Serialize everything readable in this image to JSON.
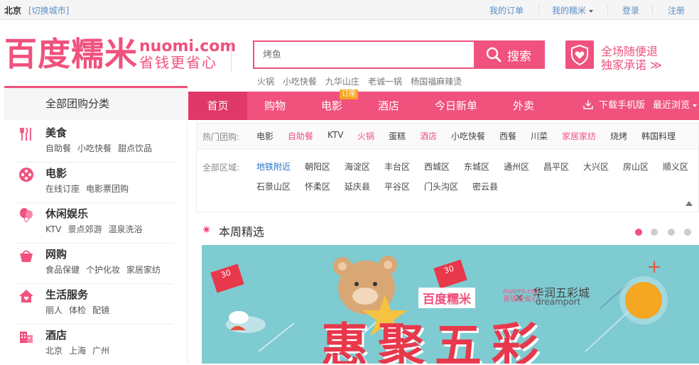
{
  "topbar": {
    "city": "北京",
    "switch_city": "[切换城市]",
    "my_orders": "我的订单",
    "my_nuomi": "我的糯米",
    "login": "登录",
    "register": "注册"
  },
  "logo": {
    "cn": "百度糯米",
    "en": "nuomi.com",
    "slogan": "省钱更省心"
  },
  "search": {
    "placeholder": "烤鱼",
    "button": "搜索",
    "hotwords": [
      "火锅",
      "小吃快餐",
      "九华山庄",
      "老诚一锅",
      "杨国福麻辣烫"
    ]
  },
  "promise": {
    "line1": "全场随便退",
    "line2": "独家承诺 ≫"
  },
  "nav": {
    "items": [
      "首页",
      "购物",
      "电影",
      "酒店",
      "今日新单",
      "外卖"
    ],
    "order_badge": "订座",
    "download": "下载手机版",
    "recent": "最近浏览"
  },
  "sidebar": {
    "title": "全部团购分类",
    "categories": [
      {
        "name": "美食",
        "subs": [
          "自助餐",
          "小吃快餐",
          "甜点饮品"
        ],
        "icon": "food-icon"
      },
      {
        "name": "电影",
        "subs": [
          "在线订座",
          "电影票团购"
        ],
        "icon": "film-reel-icon"
      },
      {
        "name": "休闲娱乐",
        "subs": [
          "KTV",
          "景点郊游",
          "温泉洗浴"
        ],
        "icon": "balloon-icon"
      },
      {
        "name": "网购",
        "subs": [
          "食品保健",
          "个护化妆",
          "家居家纺"
        ],
        "icon": "basket-icon"
      },
      {
        "name": "生活服务",
        "subs": [
          "丽人",
          "体检",
          "配镜"
        ],
        "icon": "house-icon"
      },
      {
        "name": "酒店",
        "subs": [
          "北京",
          "上海",
          "广州"
        ],
        "icon": "hotel-icon"
      }
    ]
  },
  "filter": {
    "hot_label": "热门团购:",
    "hot": [
      "电影",
      "自助餐",
      "KTV",
      "火锅",
      "蛋糕",
      "酒店",
      "小吃快餐",
      "西餐",
      "川菜",
      "家居家纺",
      "烧烤",
      "韩国料理"
    ],
    "area_label": "全部区域:",
    "areas": [
      "地铁附近",
      "朝阳区",
      "海淀区",
      "丰台区",
      "西城区",
      "东城区",
      "通州区",
      "昌平区",
      "大兴区",
      "房山区",
      "顺义区",
      "石景山区",
      "怀柔区",
      "延庆县",
      "平谷区",
      "门头沟区",
      "密云县"
    ]
  },
  "weekly": {
    "title": "本周精选"
  },
  "banner": {
    "headline": "惠聚五彩",
    "brand_cn": "百度糯米",
    "brand_en_1": "nuomi.com",
    "brand_en_2": "省钱更省心",
    "times": "×",
    "partner_cn": "华润五彩城",
    "partner_en": "dreamport",
    "coupon_1": "30",
    "coupon_2": "30"
  },
  "colors": {
    "brand": "#f0517d",
    "nav_active": "#e03869",
    "link": "#5b8fc7",
    "banner_bg": "#7ecbd2"
  }
}
